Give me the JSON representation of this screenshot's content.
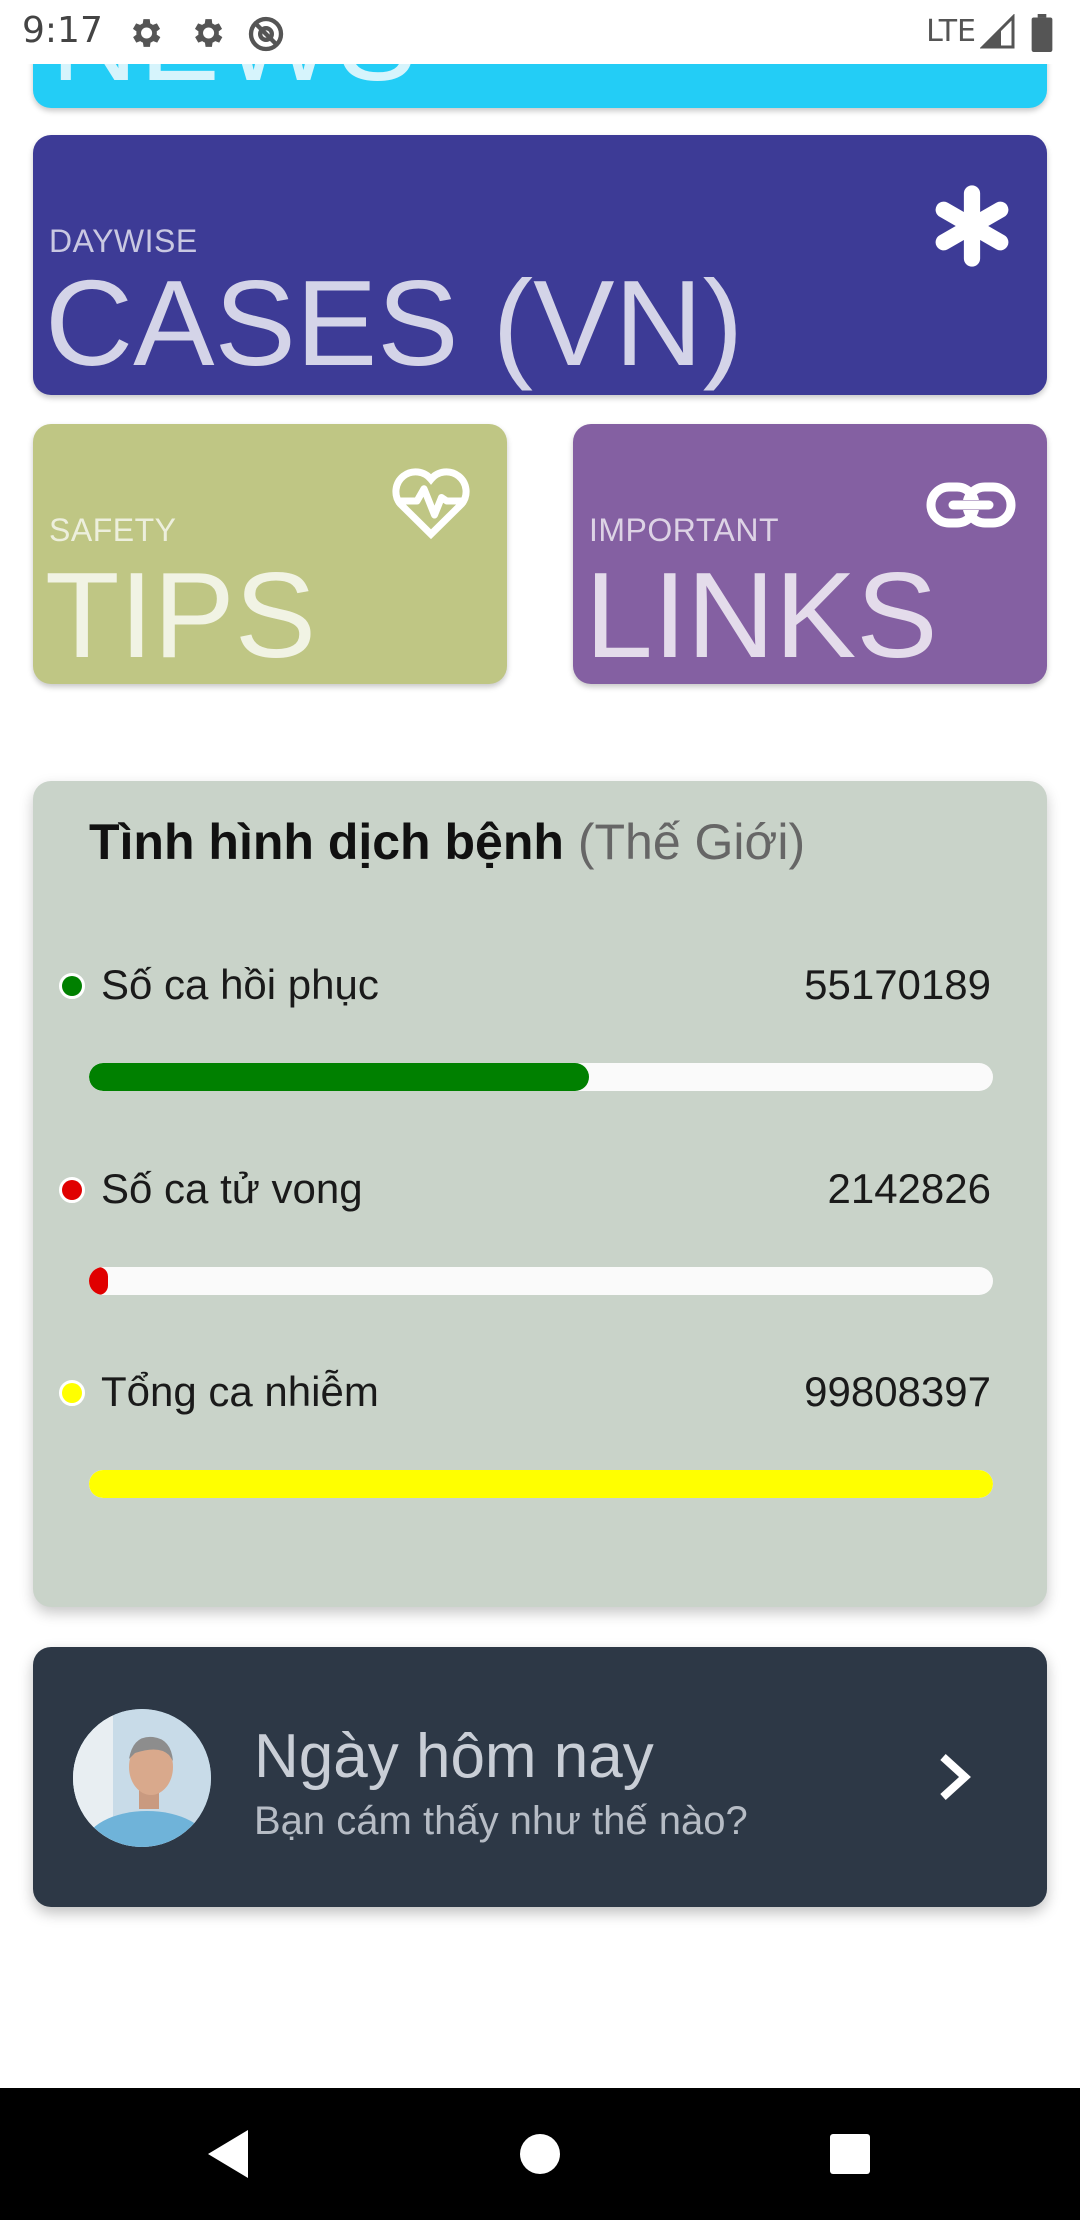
{
  "status_bar": {
    "time": "9:17",
    "network": "LTE",
    "icons": [
      "settings-icon",
      "settings-icon",
      "data-saver-icon",
      "signal-icon",
      "battery-icon"
    ]
  },
  "tiles": {
    "news": {
      "title": "NEWS",
      "color": "#23cdf6"
    },
    "cases": {
      "label": "DAYWISE",
      "title": "CASES (VN)",
      "icon": "asterisk-icon",
      "color": "#3d3b96"
    },
    "tips": {
      "label": "SAFETY",
      "title": "TIPS",
      "icon": "heart-pulse-icon",
      "color": "#bfc684"
    },
    "links": {
      "label": "IMPORTANT",
      "title": "LINKS",
      "icon": "link-icon",
      "color": "#8460a2"
    }
  },
  "stats": {
    "title": "Tình hình dịch bệnh",
    "subtitle": "(Thế Giới)",
    "rows": [
      {
        "label": "Số ca hồi phục",
        "value": "55170189",
        "fraction": 0.5527,
        "color": "#008000"
      },
      {
        "label": "Số ca tử vong",
        "value": "2142826",
        "fraction": 0.0215,
        "color": "#e00000"
      },
      {
        "label": "Tổng ca nhiễm",
        "value": "99808397",
        "fraction": 1.0,
        "color": "#ffff00"
      }
    ]
  },
  "feeling": {
    "title": "Ngày hôm nay",
    "subtitle": "Bạn cám thấy như thế nào?",
    "icon": "chevron-right-icon"
  },
  "nav": {
    "buttons": [
      "back-icon",
      "home-icon",
      "recents-icon"
    ]
  }
}
